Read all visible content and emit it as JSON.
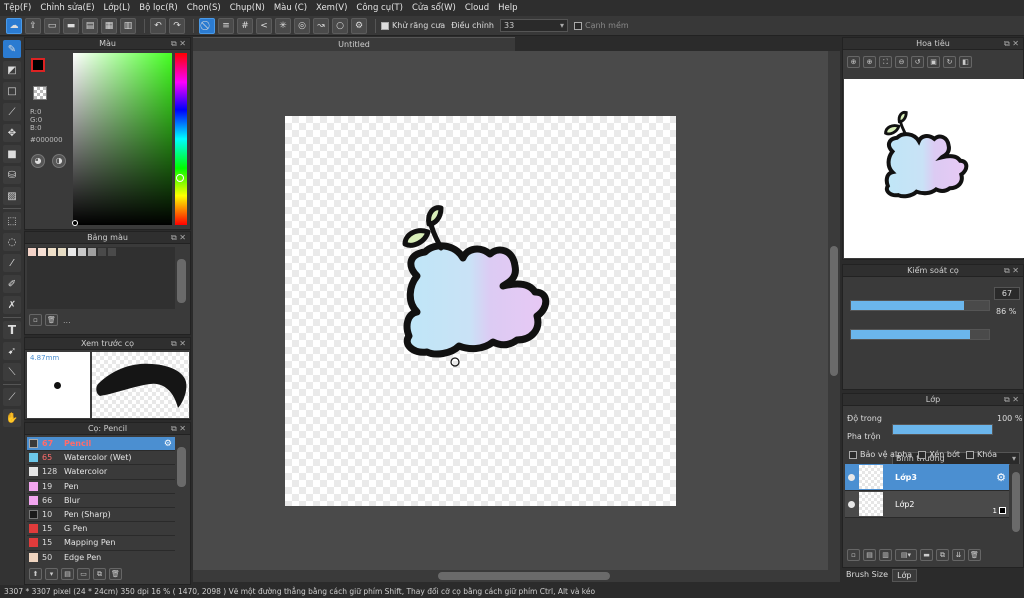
{
  "menu": [
    "Tệp(F)",
    "Chỉnh sửa(E)",
    "Lớp(L)",
    "Bộ lọc(R)",
    "Chọn(S)",
    "Chụp(N)",
    "Màu (C)",
    "Xem(V)",
    "Công cụ(T)",
    "Cửa sổ(W)",
    "Cloud",
    "Help"
  ],
  "toolbar": {
    "antialias_label": "Khử răng cưa",
    "adjust_label": "Điều chỉnh",
    "adjust_value": "33",
    "soft_edge_label": "Cạnh mềm"
  },
  "color_panel": {
    "title": "Màu",
    "r": "R:0",
    "g": "G:0",
    "b": "B:0",
    "hex": "#000000"
  },
  "palette_panel": {
    "title": "Bảng màu",
    "more": "..."
  },
  "brush_preview": {
    "title": "Xem trước cọ",
    "size": "4.87mm"
  },
  "brush_panel": {
    "title": "Cọ: Pencil",
    "brushes": [
      {
        "size": "67",
        "name": "Pencil",
        "color": "#3a3a3a"
      },
      {
        "size": "65",
        "name": "Watercolor (Wet)",
        "color": "#6cc7e8"
      },
      {
        "size": "128",
        "name": "Watercolor",
        "color": "#e6e6e6"
      },
      {
        "size": "19",
        "name": "Pen",
        "color": "#f3a6f0"
      },
      {
        "size": "66",
        "name": "Blur",
        "color": "#f3a6f0"
      },
      {
        "size": "10",
        "name": "Pen (Sharp)",
        "color": "#1a1a1a"
      },
      {
        "size": "15",
        "name": "G Pen",
        "color": "#e03b3b"
      },
      {
        "size": "15",
        "name": "Mapping Pen",
        "color": "#e03b3b"
      },
      {
        "size": "50",
        "name": "Edge Pen",
        "color": "#f0d5c0"
      }
    ]
  },
  "document": {
    "title": "Untitled"
  },
  "navigator": {
    "title": "Hoa tiêu"
  },
  "brush_control": {
    "title": "Kiểm soát cọ",
    "size_value": "67",
    "opacity_value": "86 %",
    "size_fraction": 0.82,
    "opacity_fraction": 0.86
  },
  "layer_panel": {
    "title": "Lớp",
    "opacity_label": "Độ trong",
    "opacity_value": "100 %",
    "opacity_fraction": 1.0,
    "blend_label": "Pha trộn",
    "blend_value": "Bình thường",
    "protect_alpha": "Bảo vệ alpha",
    "clipping": "Xén bớt",
    "lock": "Khóa",
    "layers": [
      {
        "name": "Lớp3",
        "selected": true
      },
      {
        "name": "Lớp2",
        "selected": false,
        "badge": "1"
      }
    ]
  },
  "bottom_tabs": [
    "Brush Size",
    "Lớp"
  ],
  "status": {
    "dimensions": "3307 * 3307 pixel",
    "physical": "(24 * 24cm)",
    "dpi": "350 dpi",
    "zoom": "16 %",
    "cursor": "( 1470, 2098 )",
    "hint": "Vẽ một đường thẳng bằng cách giữ phím Shift, Thay đổi cỡ cọ bằng cách giữ phím Ctrl, Alt và kéo"
  },
  "colors": {
    "accent": "#2b7bd1",
    "selection": "#4b8fd1",
    "foreground_color": "#000000",
    "brush_stroke": "#111111"
  }
}
